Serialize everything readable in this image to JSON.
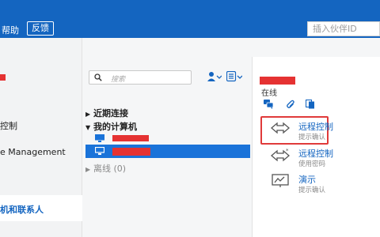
{
  "topbar": {
    "help_label": "帮助",
    "feedback_label": "反馈",
    "partner_id_placeholder": "插入伙伴ID"
  },
  "sidebar": {
    "items": [
      {
        "label": "控制"
      },
      {
        "label": "e Management"
      },
      {
        "label": "机和联系人"
      }
    ]
  },
  "search": {
    "placeholder": "搜索"
  },
  "tree": {
    "recent_label": "近期连接",
    "my_computers_label": "我的计算机",
    "offline_label": "离线 (0)"
  },
  "details": {
    "status": "在线",
    "actions": [
      {
        "name": "远程控制",
        "desc": "提示确认"
      },
      {
        "name": "远程控制",
        "desc": "使用密码"
      },
      {
        "name": "演示",
        "desc": "提示确认"
      }
    ]
  },
  "colors": {
    "brand_blue": "#1465c0",
    "selection_blue": "#1a73d9",
    "redaction_red": "#e53232"
  }
}
